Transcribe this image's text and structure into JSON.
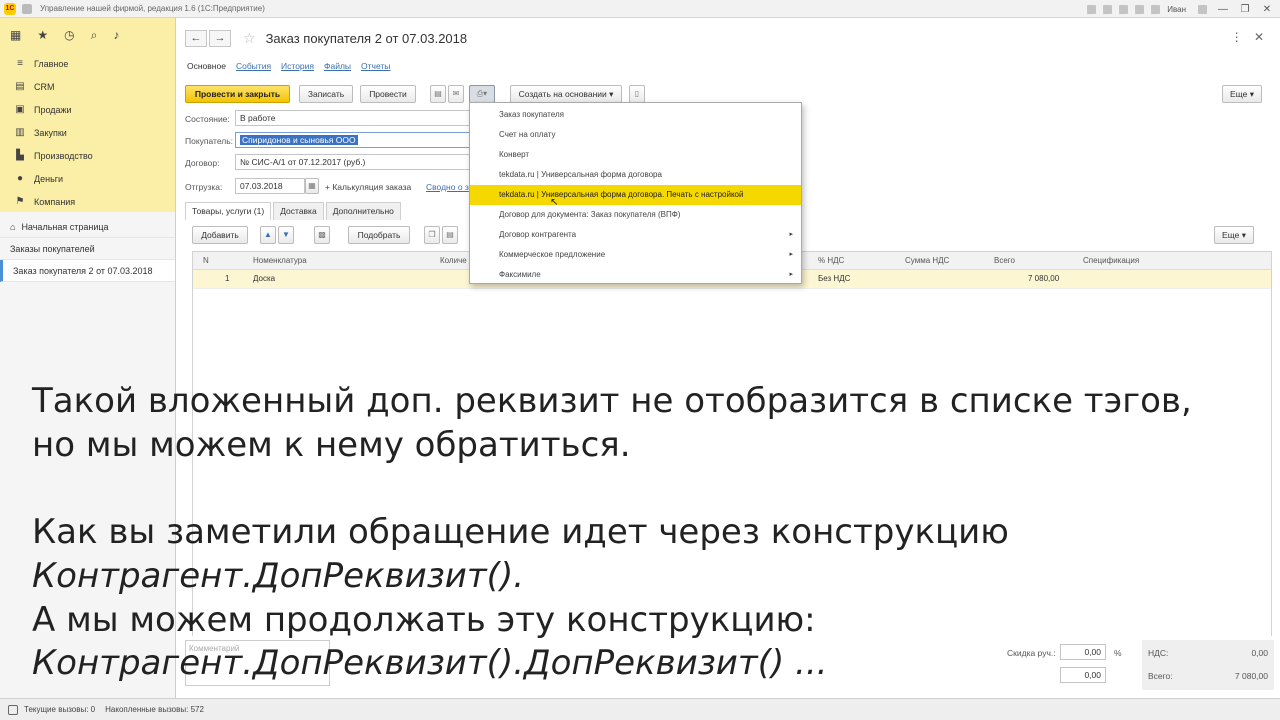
{
  "titlebar": {
    "logo": "1С",
    "title": "Управление нашей фирмой, редакция 1.6 (1С:Предприятие)",
    "user": "Иван",
    "minimize": "—",
    "restore": "❐",
    "close": "✕"
  },
  "sidebar": {
    "items": [
      {
        "label": "Главное",
        "icon": "menu-icon"
      },
      {
        "label": "CRM",
        "icon": "crm-icon"
      },
      {
        "label": "Продажи",
        "icon": "cart-icon"
      },
      {
        "label": "Закупки",
        "icon": "basket-icon"
      },
      {
        "label": "Производство",
        "icon": "factory-icon"
      },
      {
        "label": "Деньги",
        "icon": "coin-icon"
      },
      {
        "label": "Компания",
        "icon": "flag-icon"
      }
    ],
    "nav": [
      {
        "label": "Начальная страница"
      },
      {
        "label": "Заказы покупателей"
      },
      {
        "label": "Заказ покупателя 2 от 07.03.2018"
      }
    ]
  },
  "document": {
    "title": "Заказ покупателя 2 от 07.03.2018",
    "tabs": [
      "Основное",
      "События",
      "История",
      "Файлы",
      "Отчеты"
    ],
    "toolbar": {
      "post_close": "Провести и закрыть",
      "save": "Записать",
      "post": "Провести",
      "create_based": "Создать на основании",
      "more": "Еще"
    },
    "fields": {
      "state_label": "Состояние:",
      "state_value": "В работе",
      "buyer_label": "Покупатель:",
      "buyer_value": "Спиридонов и сыновья ООО",
      "contract_label": "Договор:",
      "contract_value": "№ СИС-А/1 от 07.12.2017 (руб.)",
      "shipment_label": "Отгрузка:",
      "shipment_value": "07.03.2018",
      "calc_label": "+ Калькуляция заказа",
      "free_link": "Сводно о з"
    },
    "subtabs": [
      "Товары, услуги (1)",
      "Доставка",
      "Дополнительно"
    ],
    "table_toolbar": {
      "add": "Добавить",
      "pick": "Подобрать",
      "more": "Еще"
    },
    "table": {
      "columns": [
        "N",
        "Номенклатура",
        "Количе",
        "% НДС",
        "Сумма НДС",
        "Всего",
        "Спецификация"
      ],
      "rows": [
        {
          "n": "1",
          "item": "Доска",
          "vat": "Без НДС",
          "total": "7 080,00"
        }
      ]
    },
    "footer": {
      "comment_placeholder": "Комментарий",
      "discount_label": "Скидка руч.:",
      "discount_value": "0,00",
      "percent": "%",
      "discount_value2": "0,00",
      "vat_label": "НДС:",
      "vat_value": "0,00",
      "total_label": "Всего:",
      "total_value": "7 080,00"
    }
  },
  "print_menu": {
    "items": [
      {
        "label": "Заказ покупателя",
        "submenu": false
      },
      {
        "label": "Счет на оплату",
        "submenu": false
      },
      {
        "label": "Конверт",
        "submenu": false
      },
      {
        "label": "tekdata.ru | Универсальная форма договора",
        "submenu": false
      },
      {
        "label": "tekdata.ru | Универсальная форма договора. Печать с настройкой",
        "submenu": false
      },
      {
        "label": "Договор для документа: Заказ покупателя (ВПФ)",
        "submenu": false
      },
      {
        "label": "Договор контрагента",
        "submenu": true
      },
      {
        "label": "Коммерческое предложение",
        "submenu": true
      },
      {
        "label": "Факсимиле",
        "submenu": true
      }
    ],
    "highlighted_index": 4,
    "submenu_arrow": "▸"
  },
  "statusbar": {
    "current_calls": "Текущие вызовы: 0",
    "accumulated_calls": "Накопленные вызовы: 572"
  },
  "overlay": {
    "line1": "Такой вложенный доп. реквизит не отобразится в списке тэгов,",
    "line2": "но мы можем к нему обратиться.",
    "line3": "Как вы заметили обращение идет через конструкцию",
    "line4": "Контрагент.ДопРеквизит().",
    "line5": "А мы можем продолжать эту конструкцию:",
    "line6": "Контрагент.ДопРеквизит().ДопРеквизит() ..."
  },
  "colors": {
    "accent_yellow": "#f4c400",
    "sidebar_yellow": "#fbeea7",
    "highlight": "#f5d800",
    "link": "#3a6fb0",
    "selection": "#3b73c4"
  }
}
